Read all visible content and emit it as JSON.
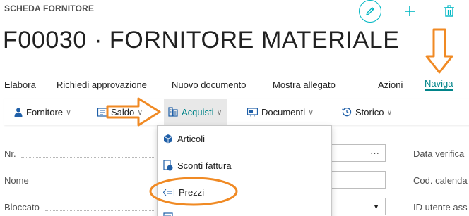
{
  "header": {
    "caption": "SCHEDA FORNITORE",
    "title": "F00030 · FORNITORE MATERIALE"
  },
  "actions": {
    "items": [
      "Elabora",
      "Richiedi approvazione",
      "Nuovo documento",
      "Mostra allegato",
      "Azioni",
      "Naviga"
    ],
    "active": "Naviga"
  },
  "menubar": {
    "tabs": [
      "Fornitore",
      "Saldo",
      "Acquisti",
      "Documenti",
      "Storico"
    ],
    "active": "Acquisti"
  },
  "dropdown": {
    "items": [
      "Articoli",
      "Sconti fattura",
      "Prezzi"
    ]
  },
  "fields": {
    "left": [
      "Nr.",
      "Nome",
      "Bloccato"
    ],
    "right": [
      "Data verifica",
      "Cod. calenda",
      "ID utente ass"
    ],
    "no_assist": "···"
  },
  "colors": {
    "accent": "#008489",
    "icon_teal": "#00b7c3",
    "annotation": "#f08a24"
  },
  "icons": [
    "edit-icon",
    "add-icon",
    "delete-icon",
    "person-icon",
    "balance-icon",
    "purchases-icon",
    "documents-icon",
    "history-icon",
    "items-icon",
    "discount-icon",
    "price-icon"
  ]
}
